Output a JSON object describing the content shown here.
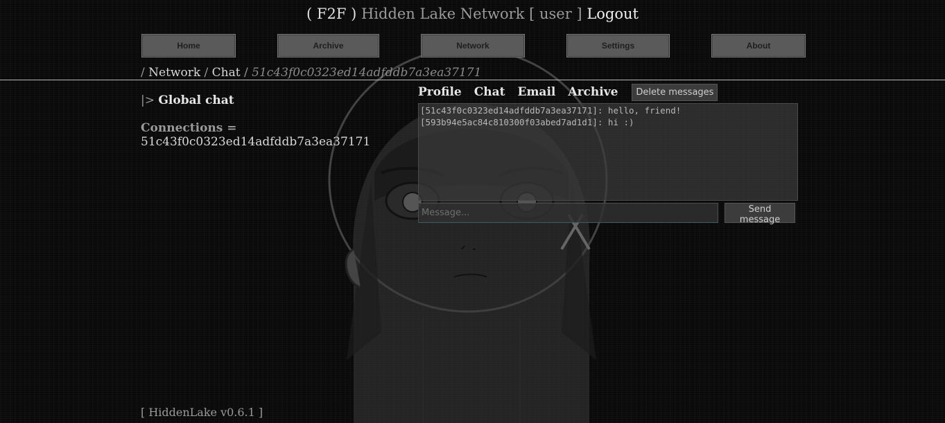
{
  "header": {
    "f2f": "( F2F )",
    "network_name": "Hidden Lake Network",
    "user": "[ user ]",
    "logout": "Logout"
  },
  "nav": {
    "items": [
      {
        "label": "Home"
      },
      {
        "label": "Archive"
      },
      {
        "label": "Network"
      },
      {
        "label": "Settings"
      },
      {
        "label": "About"
      }
    ]
  },
  "breadcrumb": {
    "sep": "/",
    "items": [
      "Network",
      "Chat"
    ],
    "current": "51c43f0c0323ed14adfddb7a3ea37171"
  },
  "left": {
    "pipe": "|>",
    "title": "Global chat",
    "connections_label": "Connections =",
    "connections_value": "51c43f0c0323ed14adfddb7a3ea37171"
  },
  "chat": {
    "tabs": [
      "Profile",
      "Chat",
      "Email",
      "Archive"
    ],
    "delete_label": "Delete messages",
    "messages": [
      "[51c43f0c0323ed14adfddb7a3ea37171]: hello, friend!",
      "[593b94e5ac84c810300f03abed7ad1d1]: hi :)"
    ],
    "input_placeholder": "Message...",
    "send_label": "Send message"
  },
  "footer": {
    "version": "[ HiddenLake v0.6.1 ]"
  }
}
